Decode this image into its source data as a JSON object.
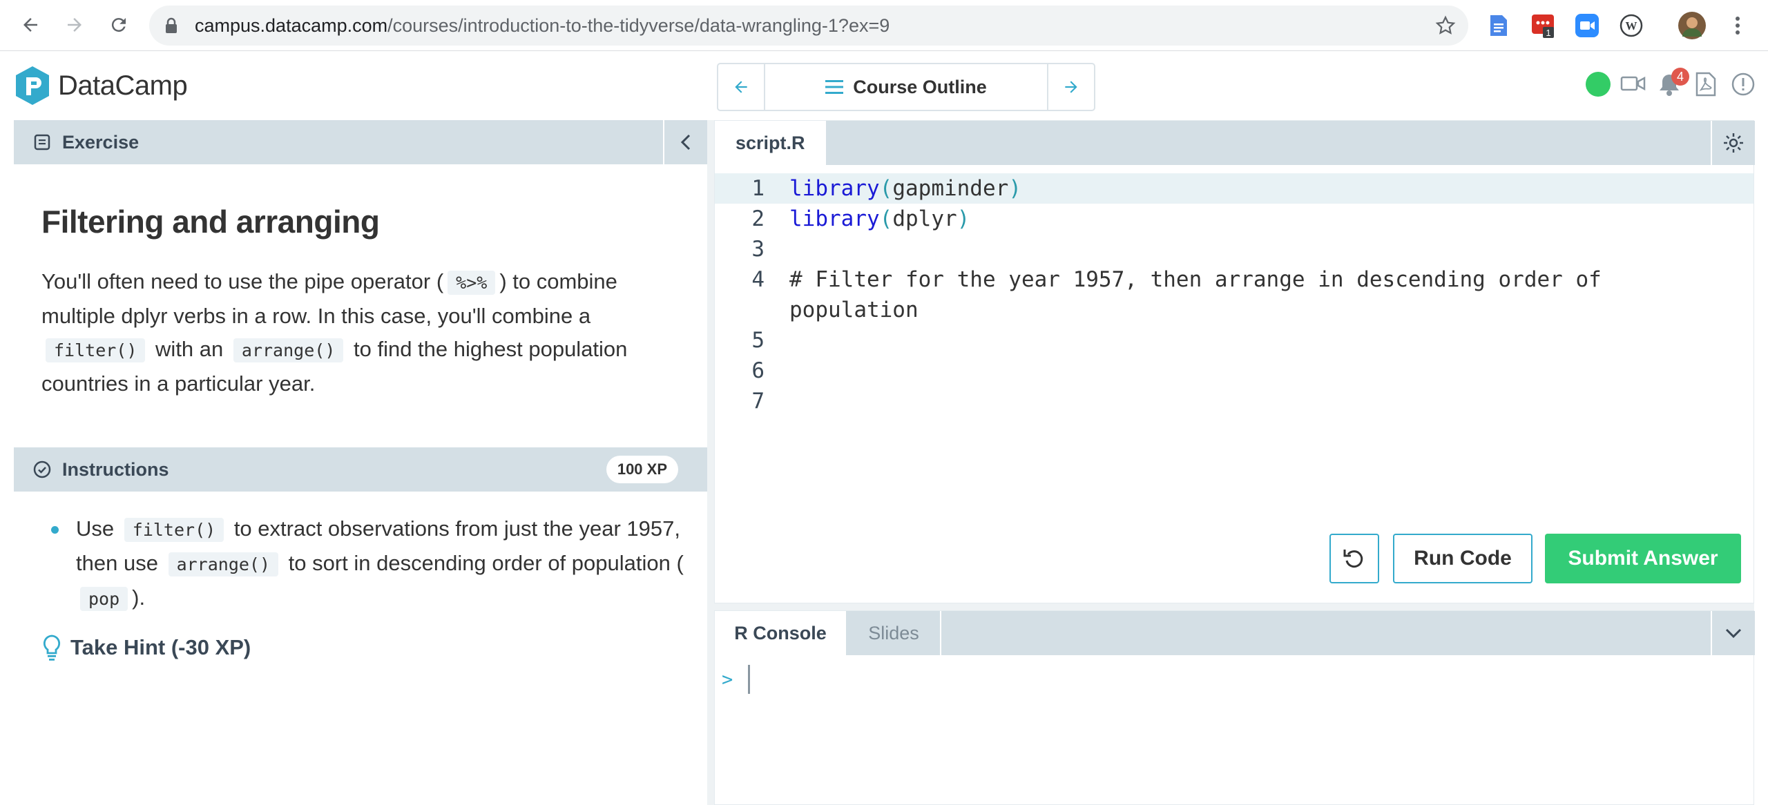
{
  "browser": {
    "url_host": "campus.datacamp.com",
    "url_path": "/courses/introduction-to-the-tidyverse/data-wrangling-1?ex=9",
    "extension_badge": "1"
  },
  "header": {
    "logo_text": "DataCamp",
    "outline_label": "Course Outline",
    "notification_count": "4",
    "status_color": "#33cc66"
  },
  "exercise": {
    "section_label": "Exercise",
    "title": "Filtering and arranging",
    "desc_1": "You'll often need to use the pipe operator (",
    "desc_code_1": "%>%",
    "desc_2": ") to combine multiple dplyr verbs in a row. In this case, you'll combine a",
    "desc_code_2": "filter()",
    "desc_3": "with an",
    "desc_code_3": "arrange()",
    "desc_4": "to find the highest population countries in a particular year."
  },
  "instructions": {
    "section_label": "Instructions",
    "xp": "100 XP",
    "t1": "Use",
    "c1": "filter()",
    "t2": "to extract observations from just the year 1957, then use",
    "c2": "arrange()",
    "t3": "to sort in descending order of population (",
    "c3": "pop",
    "t4": ").",
    "hint_label": "Take Hint (-30 XP)"
  },
  "editor": {
    "tab_label": "script.R",
    "lines": [
      {
        "num": "1",
        "fn": "library",
        "open": "(",
        "arg": "gapminder",
        "close": ")"
      },
      {
        "num": "2",
        "fn": "library",
        "open": "(",
        "arg": "dplyr",
        "close": ")"
      },
      {
        "num": "3"
      },
      {
        "num": "4",
        "comment_1": "# Filter for the year 1957, then arrange in descending order of",
        "comment_2": "population"
      },
      {
        "num": "5"
      },
      {
        "num": "6"
      },
      {
        "num": "7"
      }
    ],
    "run_label": "Run Code",
    "submit_label": "Submit Answer"
  },
  "console": {
    "tab_console": "R Console",
    "tab_slides": "Slides",
    "prompt": ">"
  },
  "colors": {
    "accent": "#33aacc",
    "submit_green": "#33cc77",
    "panel_bar": "#d4dfe5"
  }
}
